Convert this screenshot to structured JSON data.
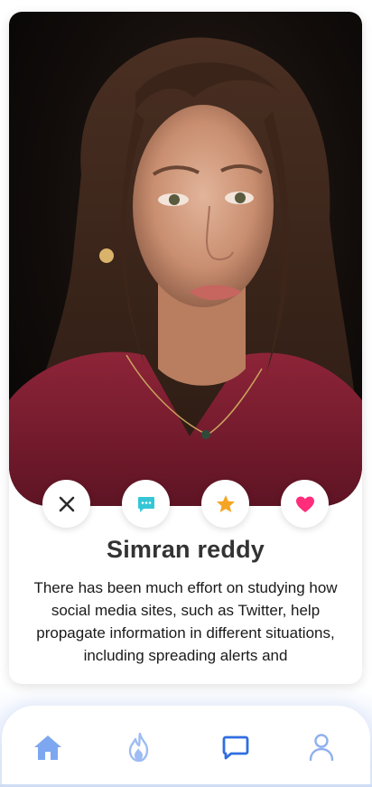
{
  "profile": {
    "name": "Simran reddy",
    "bio": "There has been much effort on studying how social media sites, such as Twitter, help propagate information in different situations, including spreading alerts and"
  },
  "actions": [
    {
      "icon": "close-icon",
      "color": "#2b2b2b"
    },
    {
      "icon": "chat-bubble-icon",
      "color": "#35c6d6"
    },
    {
      "icon": "star-icon",
      "color": "#f5a524"
    },
    {
      "icon": "heart-icon",
      "color": "#ff2d7a"
    }
  ],
  "nav": [
    {
      "icon": "home-icon",
      "color": "#7da7f0"
    },
    {
      "icon": "flame-icon",
      "color": "#9ebcf3"
    },
    {
      "icon": "chat-icon",
      "color": "#2f6ee0",
      "active": true
    },
    {
      "icon": "user-icon",
      "color": "#8fb0ee"
    }
  ],
  "colors": {
    "accent": "#2f6ee0",
    "text_dark": "#333333"
  }
}
